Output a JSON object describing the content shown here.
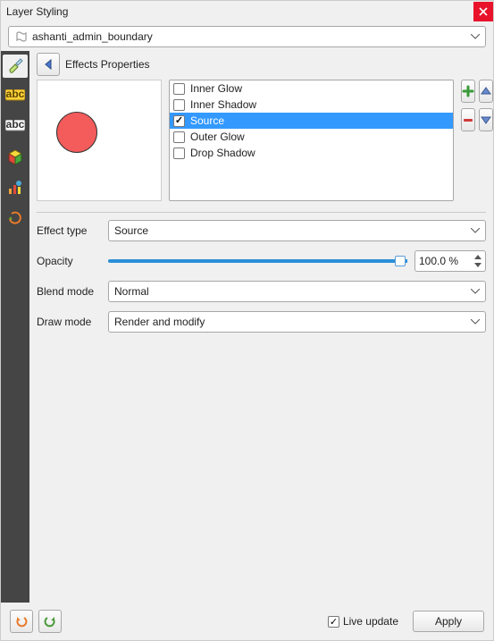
{
  "title": "Layer Styling",
  "layer_name": "ashanti_admin_boundary",
  "header": {
    "back_icon": "back-arrow-icon",
    "title": "Effects Properties"
  },
  "effects": [
    {
      "label": "Inner Glow",
      "checked": false,
      "selected": false
    },
    {
      "label": "Inner Shadow",
      "checked": false,
      "selected": false
    },
    {
      "label": "Source",
      "checked": true,
      "selected": true
    },
    {
      "label": "Outer Glow",
      "checked": false,
      "selected": false
    },
    {
      "label": "Drop Shadow",
      "checked": false,
      "selected": false
    }
  ],
  "form": {
    "effect_type": {
      "label": "Effect type",
      "value": "Source"
    },
    "opacity": {
      "label": "Opacity",
      "value": "100.0 %",
      "percent": 100
    },
    "blend_mode": {
      "label": "Blend mode",
      "value": "Normal"
    },
    "draw_mode": {
      "label": "Draw mode",
      "value": "Render and modify"
    }
  },
  "sidebuttons": {
    "add": "add-icon",
    "remove": "remove-icon",
    "up": "up-icon",
    "down": "down-icon"
  },
  "footer": {
    "undo": "undo-icon",
    "redo": "redo-icon",
    "live_label": "Live update",
    "apply": "Apply"
  },
  "colors": {
    "accent": "#3399ff",
    "preview_fill": "#f45b5b"
  }
}
